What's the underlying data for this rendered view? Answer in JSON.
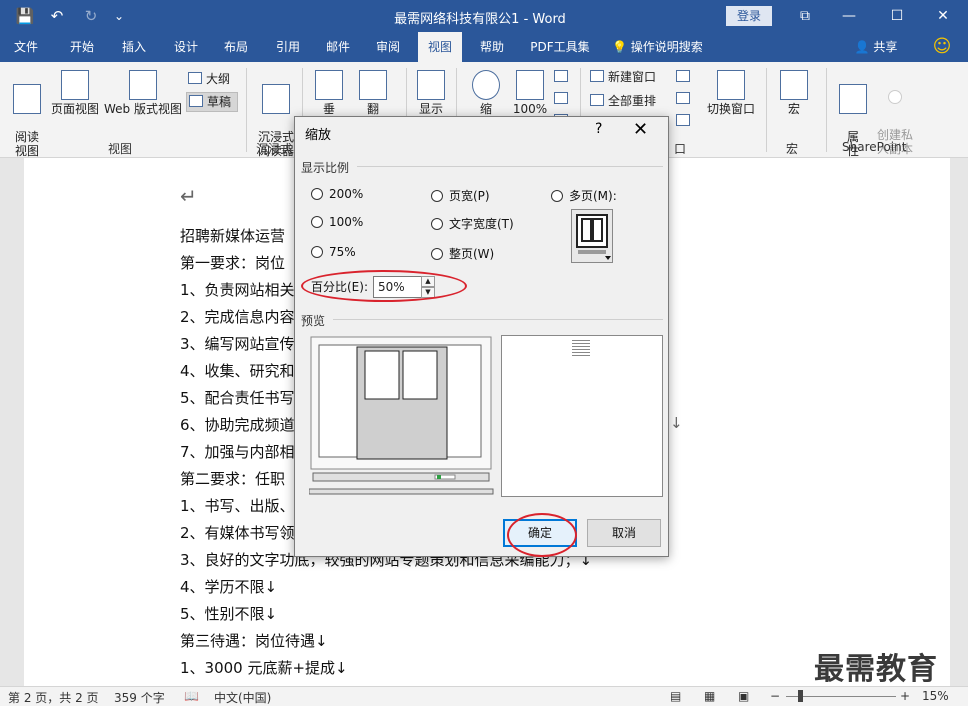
{
  "titlebar": {
    "title": "最需网络科技有限公1 - Word",
    "login": "登录",
    "save_glyph": "💾",
    "undo_glyph": "↶",
    "redo_glyph": "↻",
    "customize_glyph": "⌄",
    "ribbon_display_glyph": "⧉",
    "minimize_glyph": "—",
    "restore_glyph": "☐",
    "close_glyph": "✕"
  },
  "tabs": [
    "文件",
    "开始",
    "插入",
    "设计",
    "布局",
    "引用",
    "邮件",
    "审阅",
    "视图",
    "帮助",
    "PDF工具集",
    "操作说明搜索"
  ],
  "tab_extras": {
    "share": "共享",
    "smile": "☺"
  },
  "ribbon": {
    "read_view": "阅读\n视图",
    "page_view": "页面视图",
    "web_view": "Web 版式视图",
    "outline": "大纲",
    "draft": "草稿",
    "group_views": "视图",
    "immersive_reader": "沉浸式\n阅读器",
    "group_immersive": "沉浸式",
    "vertical": "垂",
    "flip": "翻",
    "show": "显示",
    "zoom": "缩",
    "zoom100": "100%",
    "new_window": "新建窗口",
    "arrange_all": "全部重排",
    "switch_window": "切换窗口",
    "group_window_partial": "口",
    "macro": "宏",
    "group_macro": "宏",
    "properties": "属\n性",
    "create_private": "创建私\n人副本",
    "group_sharepoint": "SharePoint"
  },
  "document": {
    "lines": [
      "↵",
      "招聘新媒体运营",
      "第一要求：岗位",
      "1、负责网站相关",
      "2、完成信息内容",
      "3、编写网站宣传",
      "4、收集、研究和",
      "5、配合责任书写",
      "6、协助完成频道",
      "7、加强与内部相",
      "第二要求：任职",
      "1、书写、出版、",
      "2、有媒体书写领",
      "3、良好的文字功底，较强的网站专题策划和信息采编能力；↓",
      "4、学历不限↓",
      "5、性别不限↓",
      "第三待遇：岗位待遇↓",
      "1、3000 元底薪+提成↓"
    ],
    "right_arrow": "↓"
  },
  "watermark": "最需教育",
  "statusbar": {
    "page": "第 2 页，共 2 页",
    "words": "359 个字",
    "lang": "中文(中国)",
    "minus": "−",
    "plus": "+",
    "zoom": "15%"
  },
  "dialog": {
    "title": "缩放",
    "help": "?",
    "close": "✕",
    "section_zoom": "显示比例",
    "radio_200": "200%",
    "radio_100": "100%",
    "radio_75": "75%",
    "radio_pagewidth": "页宽(P)",
    "radio_textwidth": "文字宽度(T)",
    "radio_wholepage": "整页(W)",
    "radio_manypages": "多页(M):",
    "percent_label": "百分比(E):",
    "percent_value": "50%",
    "section_preview": "预览",
    "ok": "确定",
    "cancel": "取消"
  },
  "colors": {
    "word_blue": "#2b579a",
    "highlight_red": "#d9232d",
    "ok_border": "#0078d7"
  }
}
